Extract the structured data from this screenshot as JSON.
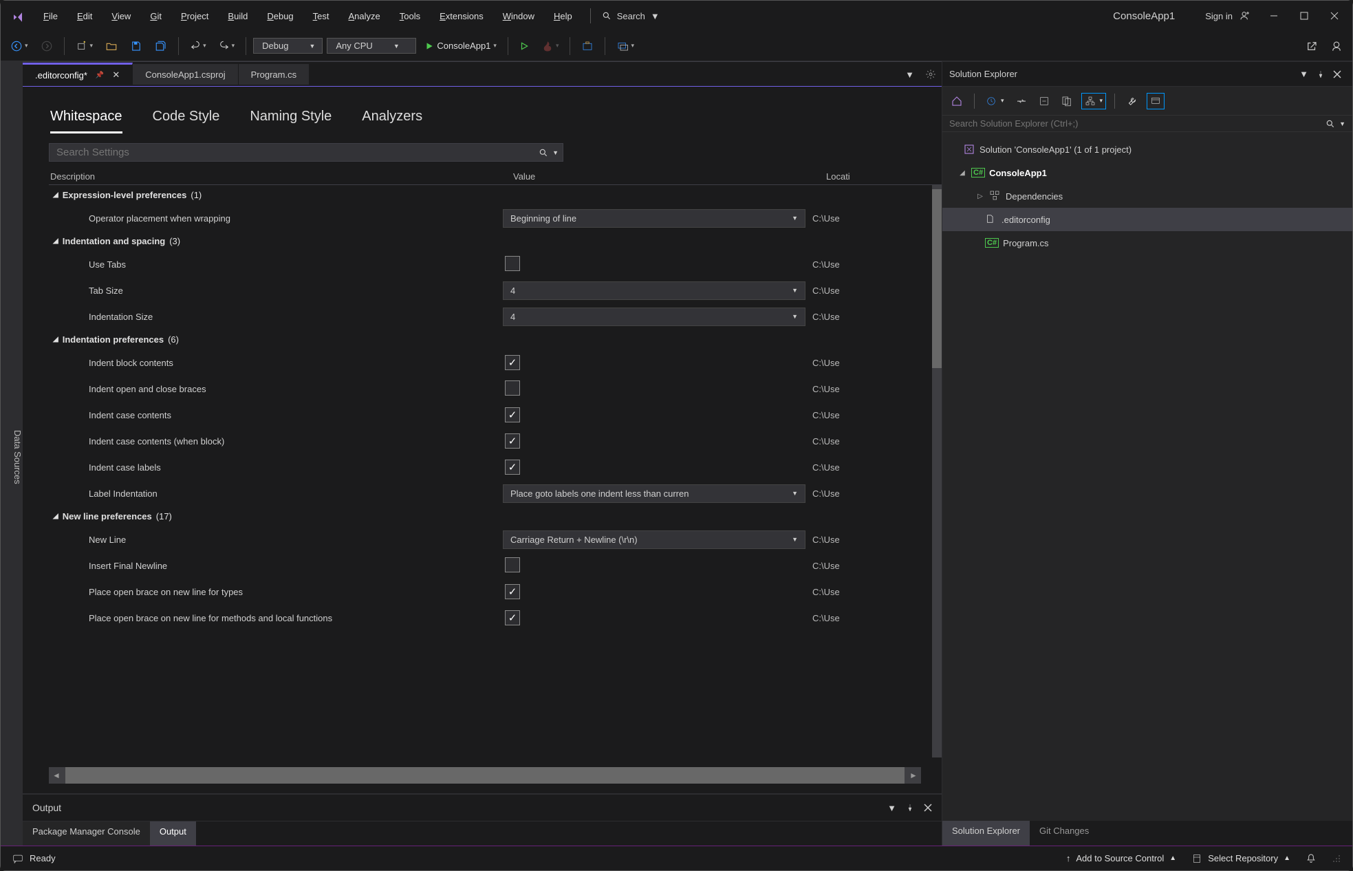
{
  "menus": [
    "File",
    "Edit",
    "View",
    "Git",
    "Project",
    "Build",
    "Debug",
    "Test",
    "Analyze",
    "Tools",
    "Extensions",
    "Window",
    "Help"
  ],
  "title_search": "Search",
  "app_title": "ConsoleApp1",
  "signin": "Sign in",
  "toolbar": {
    "config": "Debug",
    "platform": "Any CPU",
    "run_target": "ConsoleApp1"
  },
  "doc_tabs": [
    {
      "label": ".editorconfig*",
      "active": true,
      "pinned": true,
      "close": true
    },
    {
      "label": "ConsoleApp1.csproj",
      "active": false
    },
    {
      "label": "Program.cs",
      "active": false
    }
  ],
  "ec_tabs": [
    "Whitespace",
    "Code Style",
    "Naming Style",
    "Analyzers"
  ],
  "search_settings_ph": "Search Settings",
  "headers": {
    "c1": "Description",
    "c2": "Value",
    "c3": "Locati"
  },
  "loc": "C:\\Use",
  "groups": [
    {
      "title": "Expression-level preferences",
      "count": "(1)",
      "rows": [
        {
          "d": "Operator placement when wrapping",
          "t": "dd",
          "v": "Beginning of line"
        }
      ]
    },
    {
      "title": "Indentation and spacing",
      "count": "(3)",
      "rows": [
        {
          "d": "Use Tabs",
          "t": "cb",
          "v": false
        },
        {
          "d": "Tab Size",
          "t": "dd",
          "v": "4"
        },
        {
          "d": "Indentation Size",
          "t": "dd",
          "v": "4"
        }
      ]
    },
    {
      "title": "Indentation preferences",
      "count": "(6)",
      "rows": [
        {
          "d": "Indent block contents",
          "t": "cb",
          "v": true
        },
        {
          "d": "Indent open and close braces",
          "t": "cb",
          "v": false
        },
        {
          "d": "Indent case contents",
          "t": "cb",
          "v": true
        },
        {
          "d": "Indent case contents (when block)",
          "t": "cb",
          "v": true
        },
        {
          "d": "Indent case labels",
          "t": "cb",
          "v": true
        },
        {
          "d": "Label Indentation",
          "t": "dd",
          "v": "Place goto labels one indent less than curren"
        }
      ]
    },
    {
      "title": "New line preferences",
      "count": "(17)",
      "rows": [
        {
          "d": "New Line",
          "t": "dd",
          "v": "Carriage Return + Newline (\\r\\n)"
        },
        {
          "d": "Insert Final Newline",
          "t": "cb",
          "v": false
        },
        {
          "d": "Place open brace on new line for types",
          "t": "cb",
          "v": true
        },
        {
          "d": "Place open brace on new line for methods and local functions",
          "t": "cb",
          "v": true
        }
      ]
    }
  ],
  "output_title": "Output",
  "panel_tabs": [
    {
      "l": "Package Manager Console",
      "a": false
    },
    {
      "l": "Output",
      "a": true
    }
  ],
  "sidebar_label": "Data Sources",
  "sol": {
    "title": "Solution Explorer",
    "search_ph": "Search Solution Explorer (Ctrl+;)",
    "root": "Solution 'ConsoleApp1' (1 of 1 project)",
    "project": "ConsoleApp1",
    "deps": "Dependencies",
    "files": [
      ".editorconfig",
      "Program.cs"
    ]
  },
  "right_tabs": [
    {
      "l": "Solution Explorer",
      "a": true
    },
    {
      "l": "Git Changes",
      "a": false
    }
  ],
  "status": {
    "ready": "Ready",
    "src": "Add to Source Control",
    "repo": "Select Repository"
  }
}
